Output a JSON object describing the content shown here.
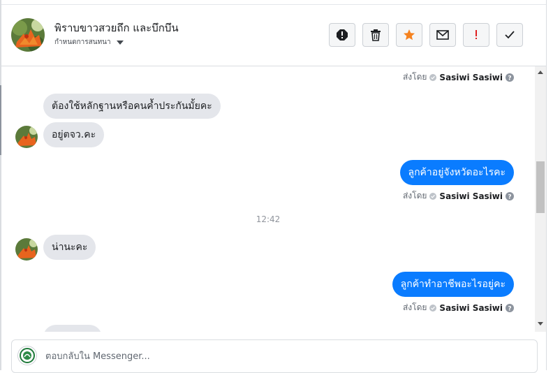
{
  "header": {
    "contact_name": "พิราบขาวสวยถึก และบึกบึน",
    "assign_label": "กำหนดการสนทนา"
  },
  "toolbar": [
    {
      "name": "spam-button",
      "icon": "alert-circle-icon"
    },
    {
      "name": "delete-button",
      "icon": "trash-icon"
    },
    {
      "name": "star-button",
      "icon": "star-icon"
    },
    {
      "name": "mark-unread-button",
      "icon": "envelope-icon"
    },
    {
      "name": "follow-up-button",
      "icon": "exclamation-icon"
    },
    {
      "name": "done-button",
      "icon": "checkmark-icon"
    }
  ],
  "messages": {
    "sent_by_prefix": "ส่งโดย",
    "sender_name": "Sasiwi Sasiwi",
    "in_1": "ต้องใช้หลักฐานหรือคนค้ำประกันมั้ยคะ",
    "in_2": "อยู่ตจว.คะ",
    "out_1": "ลูกค้าอยู่จังหวัดอะไรคะ",
    "timestamp": "12:42",
    "in_3": "น่านะคะ",
    "out_2": "ลูกค้าทำอาชีพอะไรอยู่คะ"
  },
  "composer": {
    "placeholder": "ตอบกลับใน Messenger..."
  },
  "colors": {
    "outgoing_bubble": "#0a7cff",
    "incoming_bubble": "#e4e6eb",
    "star": "#f5821f",
    "follow_up": "#e02020"
  }
}
